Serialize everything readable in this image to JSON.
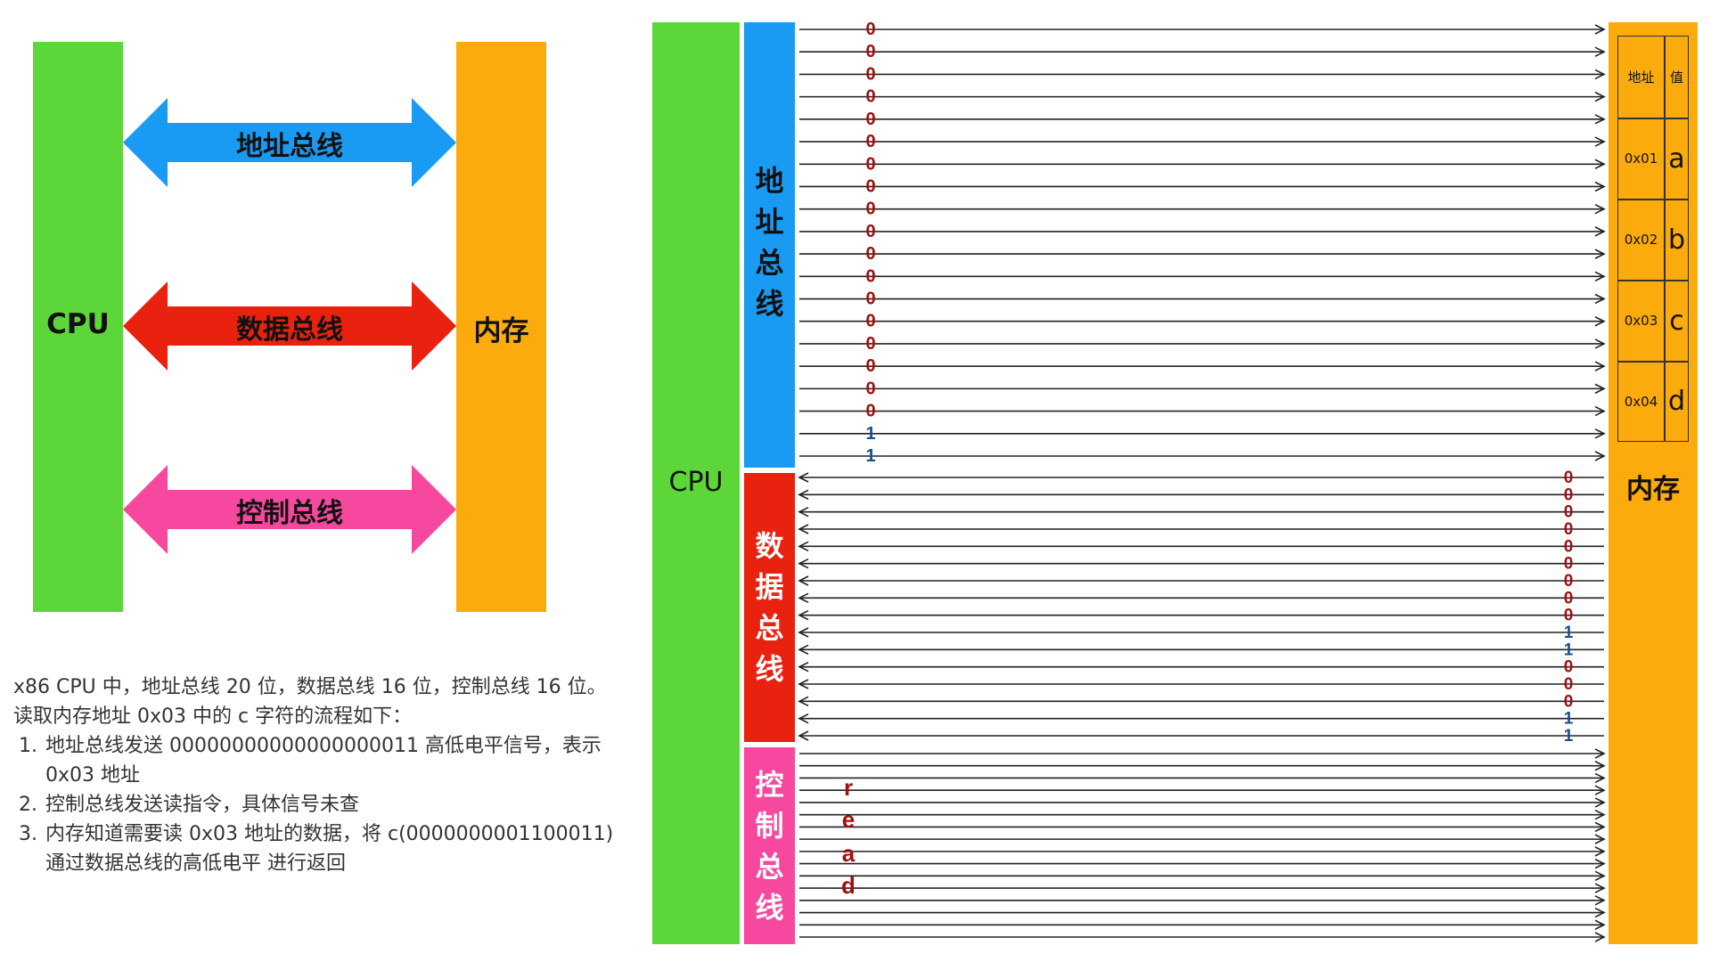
{
  "left_diagram": {
    "cpu_label": "CPU",
    "memory_label": "内存",
    "buses": [
      {
        "label": "地址总线",
        "color": "#1a9bf3"
      },
      {
        "label": "数据总线",
        "color": "#e8220f"
      },
      {
        "label": "控制总线",
        "color": "#f6489e"
      }
    ]
  },
  "description": {
    "intro": "x86 CPU 中，地址总线 20 位，数据总线 16 位，控制总线 16 位。",
    "flow_title": "读取内存地址 0x03 中的 c 字符的流程如下：",
    "steps": [
      "地址总线发送 00000000000000000011 高低电平信号，表示 0x03 地址",
      "控制总线发送读指令，具体信号未查",
      "内存知道需要读 0x03 地址的数据，将 c(0000000001100011) 通过数据总线的高低电平 进行返回"
    ]
  },
  "right_diagram": {
    "cpu_label": "CPU",
    "memory_label": "内存",
    "address_bus": {
      "label": [
        "地",
        "址",
        "总",
        "线"
      ],
      "color": "#1a9bf3",
      "bits": [
        "0",
        "0",
        "0",
        "0",
        "0",
        "0",
        "0",
        "0",
        "0",
        "0",
        "0",
        "0",
        "0",
        "0",
        "0",
        "0",
        "0",
        "0",
        "1",
        "1"
      ]
    },
    "data_bus": {
      "label": [
        "数",
        "据",
        "总",
        "线"
      ],
      "color": "#e8220f",
      "bits": [
        "0",
        "0",
        "0",
        "0",
        "0",
        "0",
        "0",
        "0",
        "0",
        "1",
        "1",
        "0",
        "0",
        "0",
        "1",
        "1"
      ]
    },
    "control_bus": {
      "label": [
        "控",
        "制",
        "总",
        "线"
      ],
      "color": "#f6489e",
      "signal": [
        "r",
        "e",
        "a",
        "d"
      ]
    },
    "bit_colors": {
      "zero": "#a01010",
      "one": "#1a4f8a"
    },
    "memory_table": {
      "headers": [
        "地址",
        "值"
      ],
      "rows": [
        {
          "addr": "0x01",
          "value": "a"
        },
        {
          "addr": "0x02",
          "value": "b"
        },
        {
          "addr": "0x03",
          "value": "c"
        },
        {
          "addr": "0x04",
          "value": "d"
        }
      ]
    }
  }
}
